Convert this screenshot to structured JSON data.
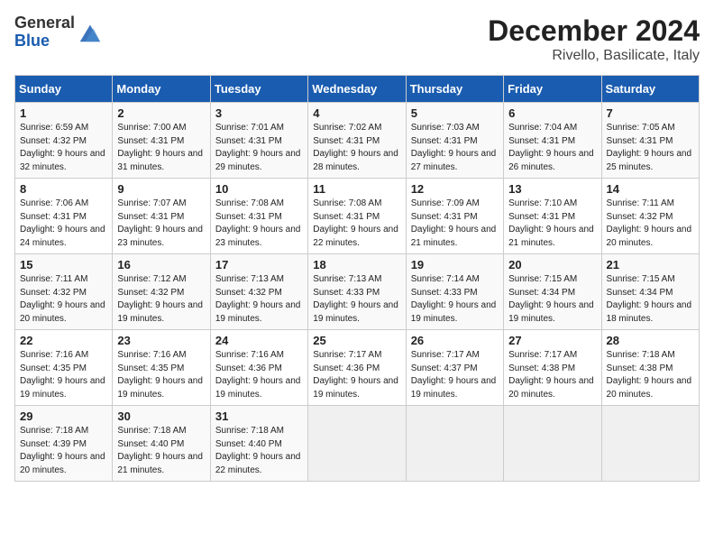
{
  "header": {
    "logo_line1": "General",
    "logo_line2": "Blue",
    "title": "December 2024",
    "subtitle": "Rivello, Basilicate, Italy"
  },
  "columns": [
    "Sunday",
    "Monday",
    "Tuesday",
    "Wednesday",
    "Thursday",
    "Friday",
    "Saturday"
  ],
  "weeks": [
    [
      {
        "day": "1",
        "sunrise": "6:59 AM",
        "sunset": "4:32 PM",
        "daylight": "9 hours and 32 minutes."
      },
      {
        "day": "2",
        "sunrise": "7:00 AM",
        "sunset": "4:31 PM",
        "daylight": "9 hours and 31 minutes."
      },
      {
        "day": "3",
        "sunrise": "7:01 AM",
        "sunset": "4:31 PM",
        "daylight": "9 hours and 29 minutes."
      },
      {
        "day": "4",
        "sunrise": "7:02 AM",
        "sunset": "4:31 PM",
        "daylight": "9 hours and 28 minutes."
      },
      {
        "day": "5",
        "sunrise": "7:03 AM",
        "sunset": "4:31 PM",
        "daylight": "9 hours and 27 minutes."
      },
      {
        "day": "6",
        "sunrise": "7:04 AM",
        "sunset": "4:31 PM",
        "daylight": "9 hours and 26 minutes."
      },
      {
        "day": "7",
        "sunrise": "7:05 AM",
        "sunset": "4:31 PM",
        "daylight": "9 hours and 25 minutes."
      }
    ],
    [
      {
        "day": "8",
        "sunrise": "7:06 AM",
        "sunset": "4:31 PM",
        "daylight": "9 hours and 24 minutes."
      },
      {
        "day": "9",
        "sunrise": "7:07 AM",
        "sunset": "4:31 PM",
        "daylight": "9 hours and 23 minutes."
      },
      {
        "day": "10",
        "sunrise": "7:08 AM",
        "sunset": "4:31 PM",
        "daylight": "9 hours and 23 minutes."
      },
      {
        "day": "11",
        "sunrise": "7:08 AM",
        "sunset": "4:31 PM",
        "daylight": "9 hours and 22 minutes."
      },
      {
        "day": "12",
        "sunrise": "7:09 AM",
        "sunset": "4:31 PM",
        "daylight": "9 hours and 21 minutes."
      },
      {
        "day": "13",
        "sunrise": "7:10 AM",
        "sunset": "4:31 PM",
        "daylight": "9 hours and 21 minutes."
      },
      {
        "day": "14",
        "sunrise": "7:11 AM",
        "sunset": "4:32 PM",
        "daylight": "9 hours and 20 minutes."
      }
    ],
    [
      {
        "day": "15",
        "sunrise": "7:11 AM",
        "sunset": "4:32 PM",
        "daylight": "9 hours and 20 minutes."
      },
      {
        "day": "16",
        "sunrise": "7:12 AM",
        "sunset": "4:32 PM",
        "daylight": "9 hours and 19 minutes."
      },
      {
        "day": "17",
        "sunrise": "7:13 AM",
        "sunset": "4:32 PM",
        "daylight": "9 hours and 19 minutes."
      },
      {
        "day": "18",
        "sunrise": "7:13 AM",
        "sunset": "4:33 PM",
        "daylight": "9 hours and 19 minutes."
      },
      {
        "day": "19",
        "sunrise": "7:14 AM",
        "sunset": "4:33 PM",
        "daylight": "9 hours and 19 minutes."
      },
      {
        "day": "20",
        "sunrise": "7:15 AM",
        "sunset": "4:34 PM",
        "daylight": "9 hours and 19 minutes."
      },
      {
        "day": "21",
        "sunrise": "7:15 AM",
        "sunset": "4:34 PM",
        "daylight": "9 hours and 18 minutes."
      }
    ],
    [
      {
        "day": "22",
        "sunrise": "7:16 AM",
        "sunset": "4:35 PM",
        "daylight": "9 hours and 19 minutes."
      },
      {
        "day": "23",
        "sunrise": "7:16 AM",
        "sunset": "4:35 PM",
        "daylight": "9 hours and 19 minutes."
      },
      {
        "day": "24",
        "sunrise": "7:16 AM",
        "sunset": "4:36 PM",
        "daylight": "9 hours and 19 minutes."
      },
      {
        "day": "25",
        "sunrise": "7:17 AM",
        "sunset": "4:36 PM",
        "daylight": "9 hours and 19 minutes."
      },
      {
        "day": "26",
        "sunrise": "7:17 AM",
        "sunset": "4:37 PM",
        "daylight": "9 hours and 19 minutes."
      },
      {
        "day": "27",
        "sunrise": "7:17 AM",
        "sunset": "4:38 PM",
        "daylight": "9 hours and 20 minutes."
      },
      {
        "day": "28",
        "sunrise": "7:18 AM",
        "sunset": "4:38 PM",
        "daylight": "9 hours and 20 minutes."
      }
    ],
    [
      {
        "day": "29",
        "sunrise": "7:18 AM",
        "sunset": "4:39 PM",
        "daylight": "9 hours and 20 minutes."
      },
      {
        "day": "30",
        "sunrise": "7:18 AM",
        "sunset": "4:40 PM",
        "daylight": "9 hours and 21 minutes."
      },
      {
        "day": "31",
        "sunrise": "7:18 AM",
        "sunset": "4:40 PM",
        "daylight": "9 hours and 22 minutes."
      },
      null,
      null,
      null,
      null
    ]
  ],
  "labels": {
    "sunrise": "Sunrise:",
    "sunset": "Sunset:",
    "daylight": "Daylight:"
  }
}
